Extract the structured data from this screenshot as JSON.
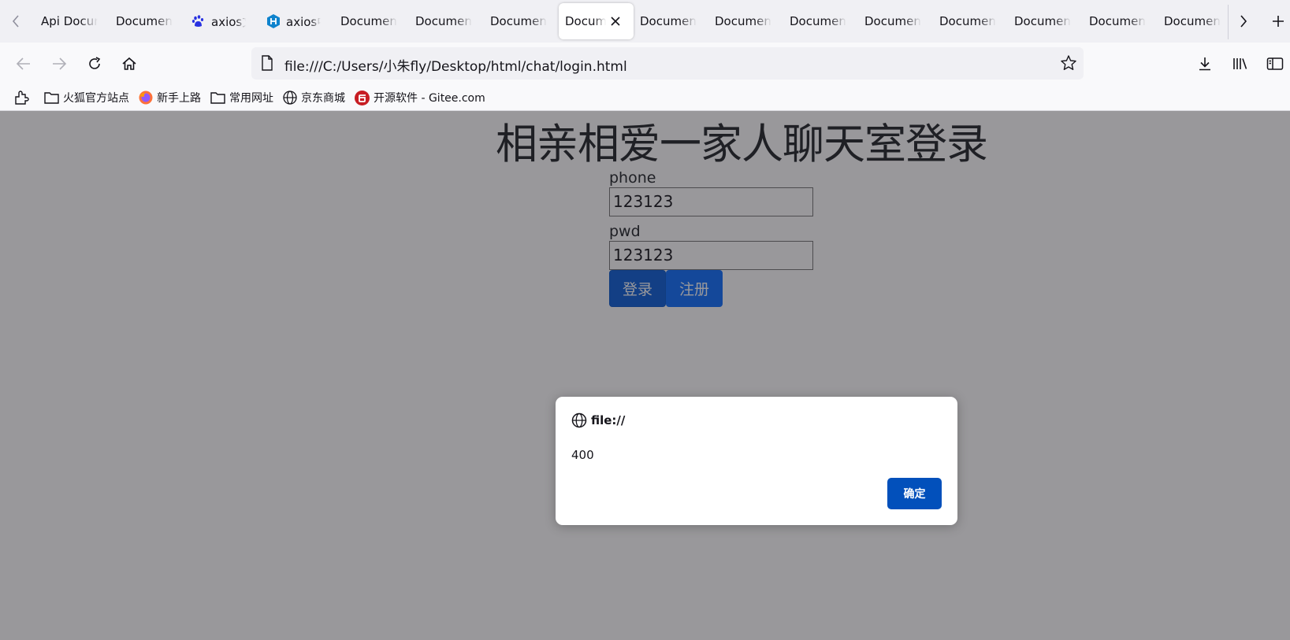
{
  "tabs": [
    {
      "label": "Api Documentation",
      "favicon": "none"
    },
    {
      "label": "Document",
      "favicon": "none"
    },
    {
      "label": "axios文档",
      "favicon": "baidu-paw-icon"
    },
    {
      "label": "axios中文文档",
      "favicon": "hexo-icon"
    },
    {
      "label": "Document",
      "favicon": "none"
    },
    {
      "label": "Document",
      "favicon": "none"
    },
    {
      "label": "Document",
      "favicon": "none"
    },
    {
      "label": "Document",
      "favicon": "none",
      "active": true
    },
    {
      "label": "Document",
      "favicon": "none"
    },
    {
      "label": "Document",
      "favicon": "none"
    },
    {
      "label": "Document",
      "favicon": "none"
    },
    {
      "label": "Document",
      "favicon": "none"
    },
    {
      "label": "Document",
      "favicon": "none"
    },
    {
      "label": "Document",
      "favicon": "none"
    },
    {
      "label": "Document",
      "favicon": "none"
    },
    {
      "label": "Document",
      "favicon": "none"
    }
  ],
  "navbar": {
    "url": "file:///C:/Users/小朱fly/Desktop/html/chat/login.html"
  },
  "bookmarks": [
    {
      "label": "",
      "icon": "bookmarks-import-icon"
    },
    {
      "label": "火狐官方站点",
      "icon": "folder-icon"
    },
    {
      "label": "新手上路",
      "icon": "firefox-icon"
    },
    {
      "label": "常用网址",
      "icon": "folder-icon"
    },
    {
      "label": "京东商城",
      "icon": "globe-icon"
    },
    {
      "label": "开源软件 - Gitee.com",
      "icon": "gitee-icon"
    }
  ],
  "page": {
    "title": "相亲相爱一家人聊天室登录",
    "phone_label": "phone",
    "phone_value": "123123",
    "pwd_label": "pwd",
    "pwd_value": "123123",
    "login_button": "登录",
    "register_button": "注册"
  },
  "dialog": {
    "origin": "file://",
    "message": "400",
    "ok_button": "确定"
  },
  "colors": {
    "primary_button": "#0d6efd",
    "dialog_ok": "#0250bb",
    "overlay": "rgba(28,27,34,0.45)"
  }
}
